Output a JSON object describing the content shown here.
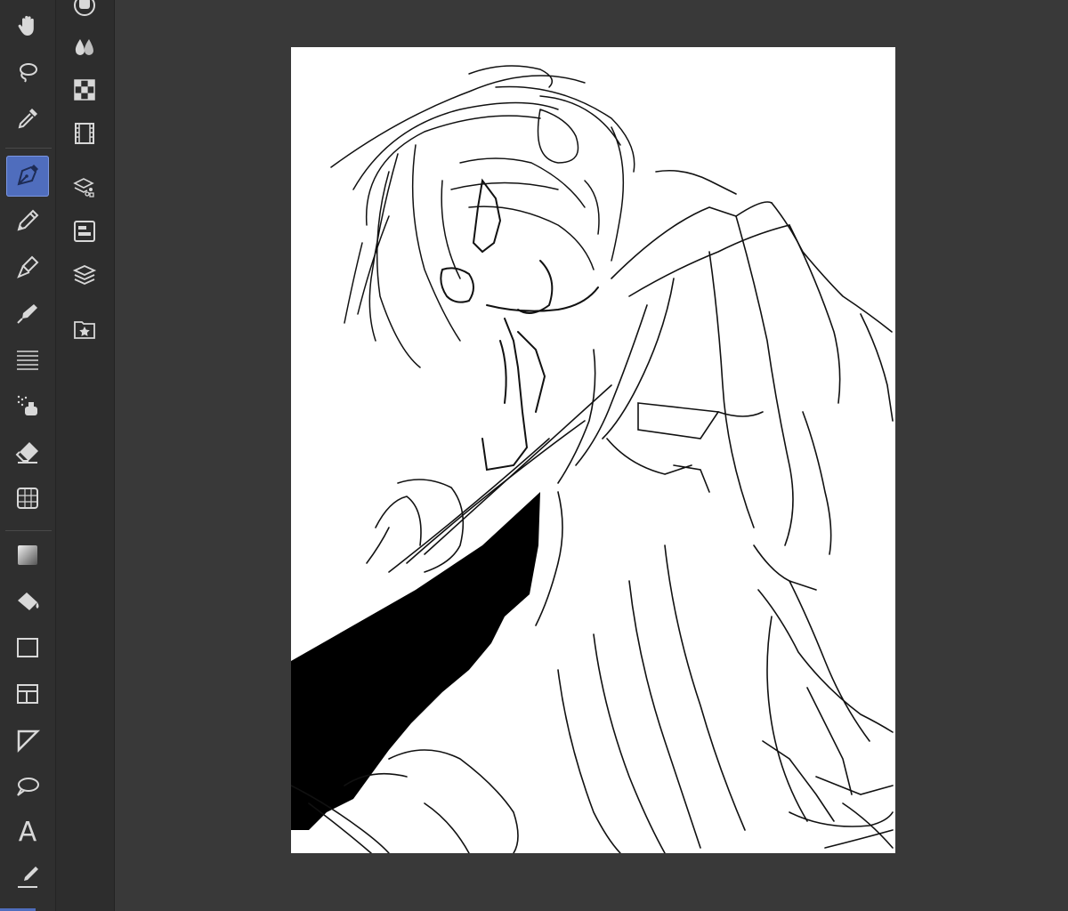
{
  "app": {
    "type": "drawing-application",
    "theme": "dark"
  },
  "colors": {
    "accent": "#4f6dbd",
    "toolbar_bg": "#2f2f2f",
    "canvas_bg": "#393939",
    "paper": "#ffffff",
    "ink": "#000000"
  },
  "toolbar": {
    "selected_tool": "pen-tool",
    "tools": [
      {
        "name": "hand-tool",
        "icon": "hand-icon"
      },
      {
        "name": "lasso-select-tool",
        "icon": "lasso-icon"
      },
      {
        "name": "eyedropper-tool",
        "icon": "eyedropper-icon"
      },
      {
        "name": "pen-tool",
        "icon": "pen-nib-icon",
        "selected": true
      },
      {
        "name": "pencil-tool",
        "icon": "pencil-icon"
      },
      {
        "name": "brush-tool",
        "icon": "brush-icon"
      },
      {
        "name": "decoration-tool",
        "icon": "decoration-icon"
      },
      {
        "name": "lines-tool",
        "icon": "lines-icon"
      },
      {
        "name": "airbrush-tool",
        "icon": "airbrush-icon"
      },
      {
        "name": "eraser-tool",
        "icon": "eraser-icon"
      },
      {
        "name": "blend-tool",
        "icon": "blend-icon"
      },
      {
        "name": "gradient-tool",
        "icon": "gradient-icon"
      },
      {
        "name": "fill-tool",
        "icon": "paint-bucket-icon"
      },
      {
        "name": "figure-tool",
        "icon": "rectangle-icon"
      },
      {
        "name": "frame-border-tool",
        "icon": "frame-border-icon"
      },
      {
        "name": "ruler-tool",
        "icon": "ruler-icon"
      },
      {
        "name": "balloon-tool",
        "icon": "speech-balloon-icon"
      },
      {
        "name": "text-tool",
        "icon": "text-icon",
        "label": "A"
      },
      {
        "name": "correct-line-tool",
        "icon": "correct-line-icon"
      }
    ]
  },
  "palettes": [
    {
      "name": "color-wheel-palette",
      "icon": "color-circle-icon"
    },
    {
      "name": "color-drops-palette",
      "icon": "color-drops-icon"
    },
    {
      "name": "color-set-palette",
      "icon": "color-grid-icon"
    },
    {
      "name": "timeline-palette",
      "icon": "film-strip-icon"
    },
    {
      "name": "layer-property-palette",
      "icon": "layer-property-icon"
    },
    {
      "name": "navigator-palette",
      "icon": "navigator-icon"
    },
    {
      "name": "layers-palette",
      "icon": "layers-icon"
    },
    {
      "name": "materials-palette",
      "icon": "star-folder-icon"
    }
  ],
  "canvas": {
    "content": "line-art-sketch"
  },
  "text_tool_label": "A"
}
